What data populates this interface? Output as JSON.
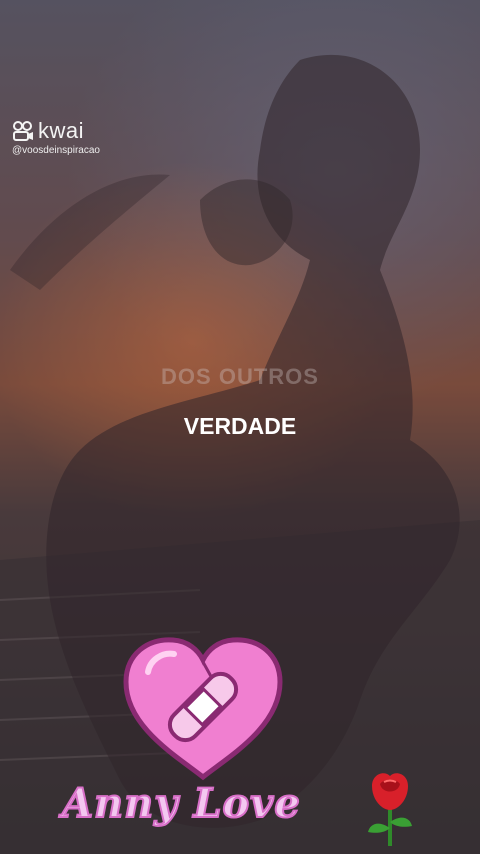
{
  "watermark": {
    "brand": "kwai",
    "handle": "@voosdeinspiracao"
  },
  "captions": {
    "faded": "DOS OUTROS",
    "main": "VERDADE"
  },
  "sticker": {
    "signature": "Anny Love"
  },
  "icons": {
    "kwai_logo": "kwai-logo-icon",
    "heart": "bandaged-heart-icon",
    "rose": "rose-icon"
  },
  "colors": {
    "heart_pink": "#f07fd0",
    "signature_pink": "#f3c8f0",
    "rose_red": "#d8202a"
  }
}
